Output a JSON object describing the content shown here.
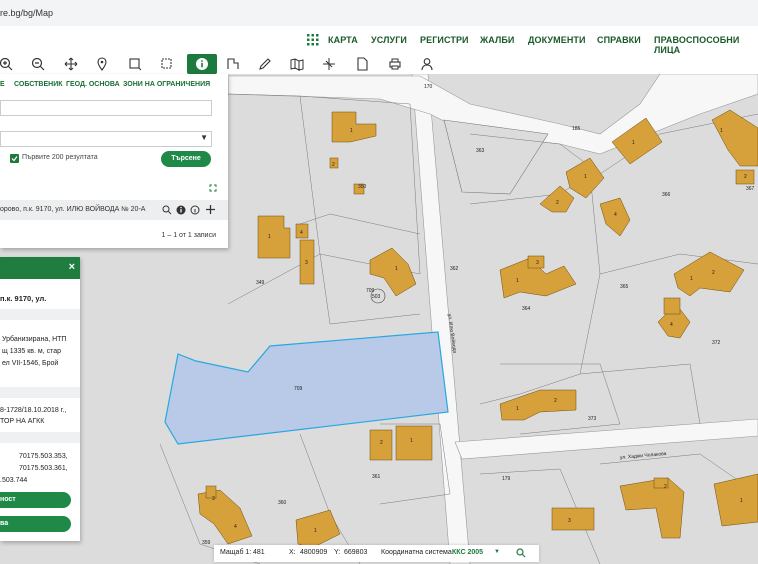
{
  "browser": {
    "url": "re.bg/bg/Map"
  },
  "nav": {
    "items": [
      "КАРТА",
      "УСЛУГИ",
      "РЕГИСТРИ",
      "ЖАЛБИ",
      "ДОКУМЕНТИ",
      "СПРАВКИ",
      "ПРАВОСПОСОБНИ ЛИЦА"
    ]
  },
  "toolbar": {
    "tools": [
      "zoom-in-icon",
      "zoom-out-icon",
      "pan-icon",
      "marker-icon",
      "select-rect-icon",
      "select-area-icon",
      "info-icon",
      "measure-icon",
      "draw-icon",
      "map-icon",
      "layers-icon",
      "document-icon",
      "print-icon",
      "user-icon"
    ]
  },
  "search_panel": {
    "tabs": [
      "Е",
      "СОБСТВЕНИК",
      "ГЕОД. ОСНОВА",
      "ЗОНИ НА ОГРАНИЧЕНИЯ"
    ],
    "first_200_label": "Първите 200 резултата",
    "search_button": "Търсене",
    "result_text": "орово, п.к. 9170, ул. ИЛЮ ВОЙВОДА № 20-А",
    "result_count": "1 – 1 от 1 записи"
  },
  "info_panel": {
    "close": "×",
    "address": "п.к. 9170, ул.",
    "lines": [
      "Урбанизирана, НТП",
      "щ 1335 кв. м, стар",
      "ел VII-1546, Брой"
    ],
    "order_lines": [
      "8-1728/18.10.2018 г.,",
      "ТОР НА АГКК"
    ],
    "neighbors": [
      "70175.503.353,",
      "70175.503.361,",
      ".503.744"
    ],
    "button1": "ност",
    "button2": "ва"
  },
  "map": {
    "parcel_labels": [
      "350",
      "349",
      "709",
      "503",
      "362",
      "363",
      "364",
      "365",
      "366",
      "367",
      "372",
      "373",
      "361",
      "360",
      "359",
      "179",
      "170",
      "185"
    ],
    "street_labels": [
      "ул. Илю Войвода",
      "ул. Хаджи Чолакова"
    ],
    "building_labels": [
      "1",
      "2",
      "3",
      "4"
    ]
  },
  "status_bar": {
    "scale_label": "Мащаб 1:",
    "scale_value": "481",
    "x_label": "X:",
    "x_value": "4800909",
    "y_label": "Y:",
    "y_value": "669803",
    "coord_label": "Координатна система:",
    "coord_system": "ККС 2005"
  },
  "colors": {
    "brand_green": "#1c7a3e",
    "building": "#d6a03a",
    "parcel_highlight": "#b9c9e8",
    "parcel_fill": "#dcdcdc"
  }
}
